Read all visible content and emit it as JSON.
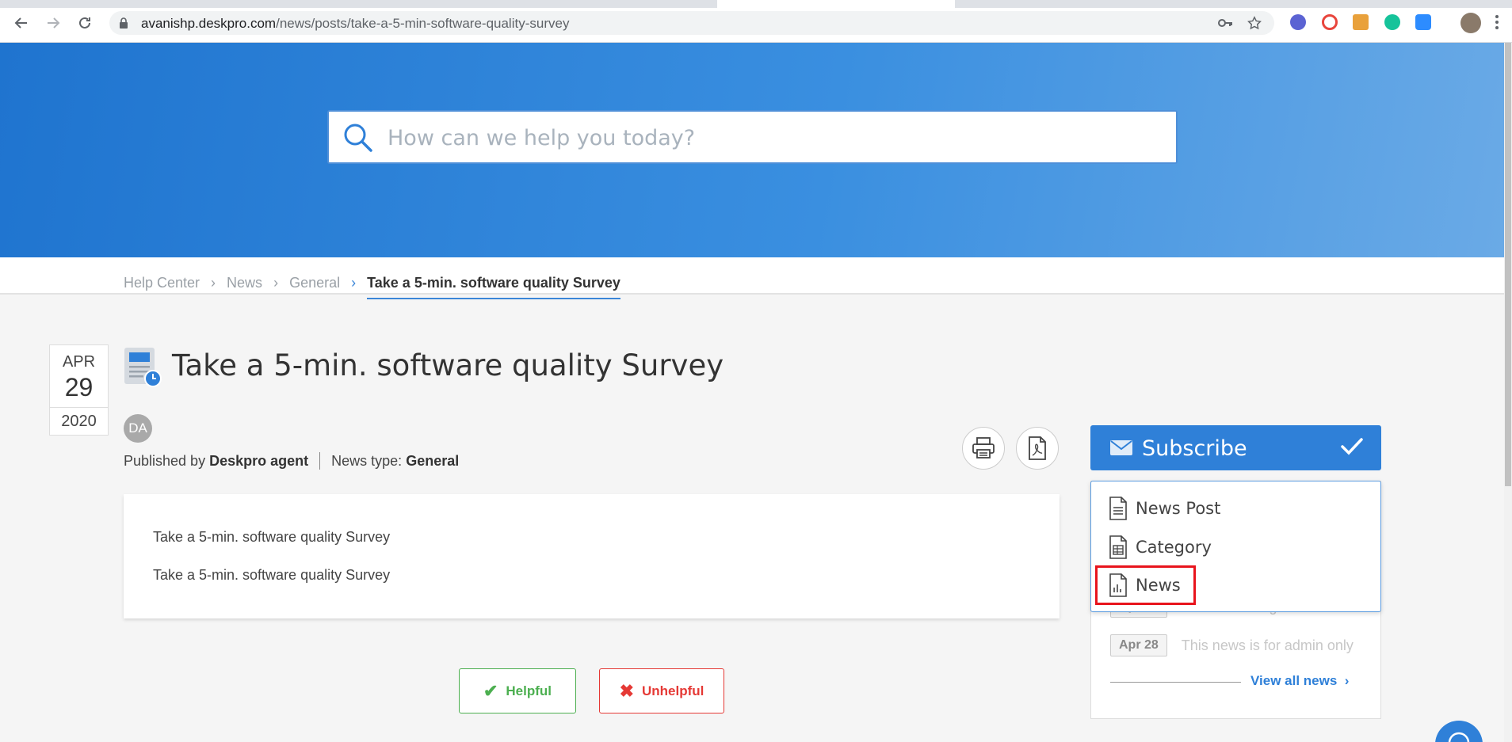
{
  "browser": {
    "url_host": "avanishp.deskpro.com",
    "url_path": "/news/posts/take-a-5-min-software-quality-survey"
  },
  "search": {
    "placeholder": "How can we help you today?"
  },
  "breadcrumb": {
    "items": [
      "Help Center",
      "News",
      "General"
    ],
    "current": "Take a 5-min. software quality Survey"
  },
  "post": {
    "date": {
      "month": "APR",
      "day": "29",
      "year": "2020"
    },
    "title": "Take a 5-min. software quality Survey",
    "avatar_initials": "DA",
    "published_by_label": "Published by",
    "author": "Deskpro agent",
    "news_type_label": "News type:",
    "news_type": "General",
    "body": [
      "Take a 5-min. software quality Survey",
      "Take a 5-min. software quality Survey"
    ]
  },
  "feedback": {
    "helpful_label": "Helpful",
    "unhelpful_label": "Unhelpful"
  },
  "sidebar": {
    "subscribe_label": "Subscribe",
    "dropdown": [
      {
        "label": "News Post",
        "icon": "document-icon"
      },
      {
        "label": "Category",
        "icon": "table-document-icon"
      },
      {
        "label": "News",
        "icon": "chart-document-icon"
      }
    ],
    "news": [
      {
        "date": "Apr 28",
        "title": "We are coming with new..."
      },
      {
        "date": "Apr 28",
        "title": "This news is for admin only"
      }
    ],
    "view_all_label": "View all news"
  },
  "colors": {
    "accent": "#2f80d8",
    "helpful": "#4caf50",
    "unhelpful": "#e53935",
    "highlight_box": "#e8141c"
  }
}
